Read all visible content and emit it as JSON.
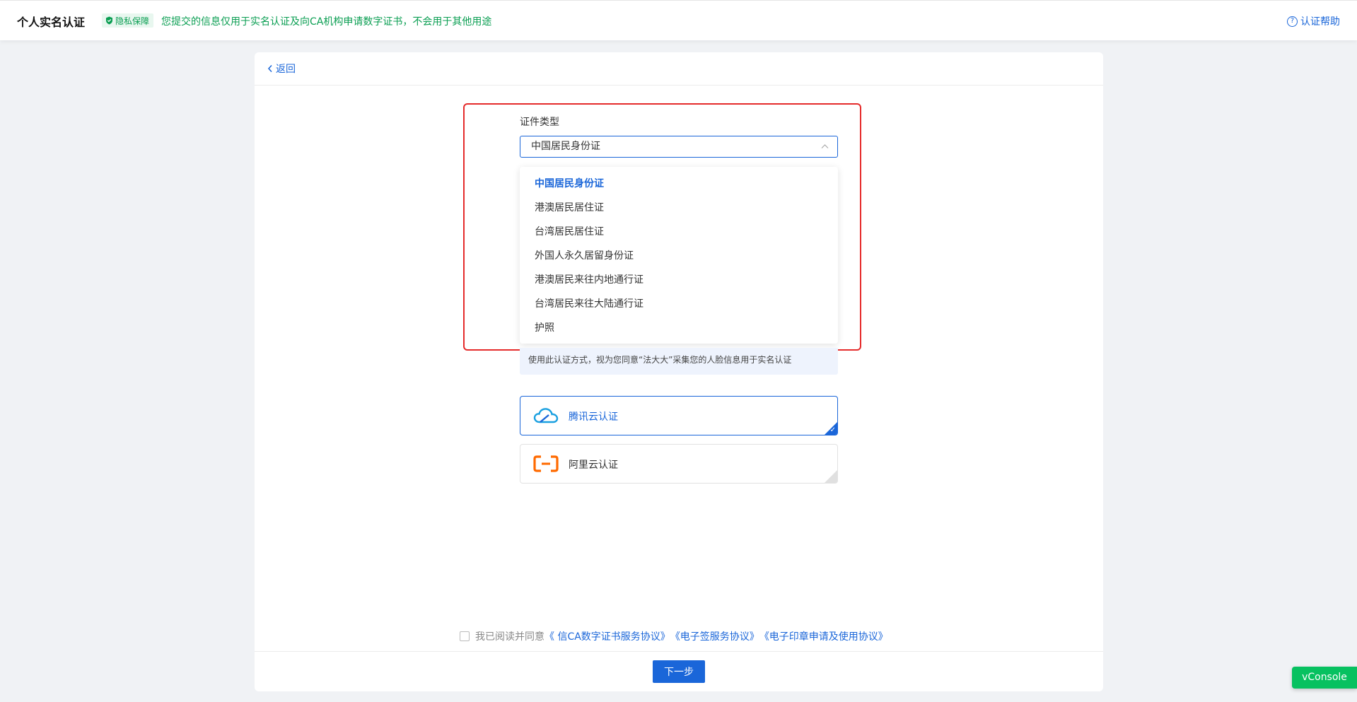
{
  "header": {
    "title": "个人实名认证",
    "privacy_badge": "隐私保障",
    "privacy_text": "您提交的信息仅用于实名认证及向CA机构申请数字证书，不会用于其他用途",
    "help_label": "认证帮助"
  },
  "card": {
    "back_label": "返回"
  },
  "form": {
    "id_type_label": "证件类型",
    "id_type_value": "中国居民身份证",
    "options": [
      "中国居民身份证",
      "港澳居民居住证",
      "台湾居民居住证",
      "外国人永久居留身份证",
      "港澳居民来往内地通行证",
      "台湾居民来往大陆通行证",
      "护照"
    ],
    "notice": "使用此认证方式，视为您同意“法大大”采集您的人脸信息用于实名认证"
  },
  "methods": {
    "tencent": "腾讯云认证",
    "aliyun": "阿里云认证"
  },
  "agreement": {
    "prefix": "我已阅读并同意",
    "link1": "《 信CA数字证书服务协议》",
    "link2": "《电子签服务协议》",
    "link3": "《电子印章申请及使用协议》"
  },
  "footer": {
    "next_label": "下一步"
  },
  "vconsole_label": "vConsole",
  "colors": {
    "primary": "#1a66d9",
    "privacy_green": "#0a9e52",
    "highlight_red": "#e52b2b",
    "vconsole_green": "#07c160"
  }
}
